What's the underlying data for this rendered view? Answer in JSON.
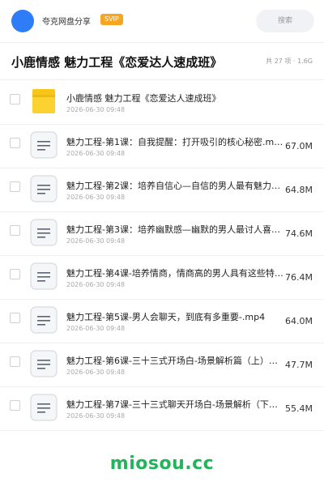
{
  "topbar": {
    "user_name": "夸克网盘分享",
    "badge": "SVIP",
    "search_placeholder": "搜索"
  },
  "folder": {
    "title": "小鹿情感 魅力工程《恋爱达人速成班》",
    "meta": "共 27 项 · 1.6G"
  },
  "files": [
    {
      "name": "小鹿情感 魅力工程《恋爱达人速成班》",
      "date": "2026-06-30 09:48",
      "size": "",
      "type": "folder",
      "icon": "folder-icon"
    },
    {
      "name": "魅力工程-第1课：自我提醒：打开吸引的核心秘密.mp4",
      "date": "2026-06-30 09:48",
      "size": "67.0M",
      "type": "video",
      "icon": "file-icon"
    },
    {
      "name": "魅力工程-第2课：培养自信心—自信的男人最有魅力（…",
      "date": "2026-06-30 09:48",
      "size": "64.8M",
      "type": "video",
      "icon": "file-icon"
    },
    {
      "name": "魅力工程-第3课：培养幽默感—幽默的男人最讨人喜欢…",
      "date": "2026-06-30 09:48",
      "size": "74.6M",
      "type": "video",
      "icon": "file-icon"
    },
    {
      "name": "魅力工程-第4课-培养情商，情商高的男人具有这些特…",
      "date": "2026-06-30 09:48",
      "size": "76.4M",
      "type": "video",
      "icon": "file-icon"
    },
    {
      "name": "魅力工程-第5课-男人会聊天，到底有多重要-.mp4",
      "date": "2026-06-30 09:48",
      "size": "64.0M",
      "type": "video",
      "icon": "file-icon"
    },
    {
      "name": "魅力工程-第6课-三十三式开场白-场景解析篇（上）…",
      "date": "2026-06-30 09:48",
      "size": "47.7M",
      "type": "video",
      "icon": "file-icon"
    },
    {
      "name": "魅力工程-第7课-三十三式聊天开场白-场景解析（下…",
      "date": "2026-06-30 09:48",
      "size": "55.4M",
      "type": "video",
      "icon": "file-icon"
    }
  ],
  "watermark": "miosou.cc",
  "colors": {
    "accent": "#2f7df6",
    "badge": "#f5a623",
    "folder": "#f8c61b",
    "watermark": "#23b35b"
  }
}
